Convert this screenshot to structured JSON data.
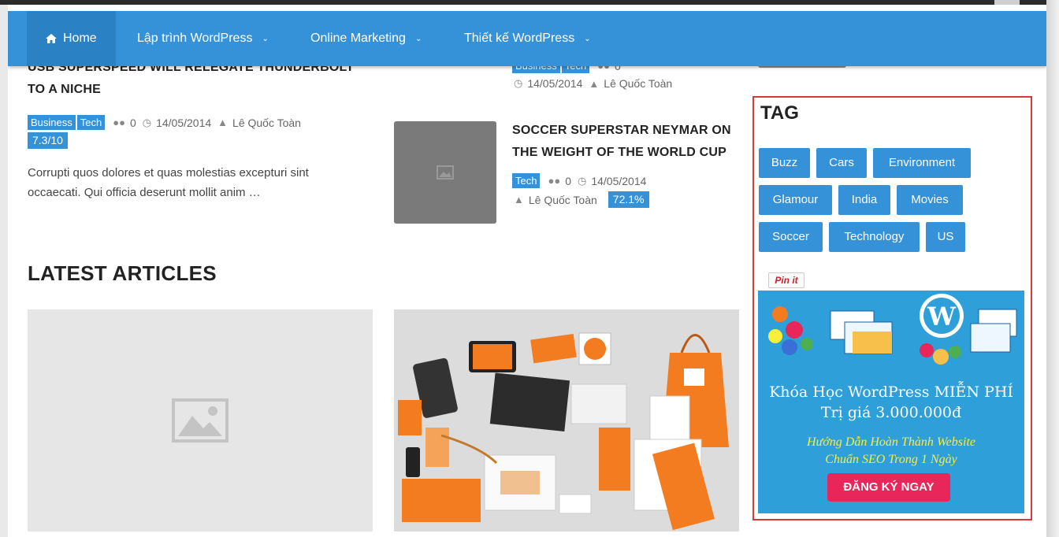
{
  "nav": {
    "items": [
      {
        "label": "Home",
        "active": true
      },
      {
        "label": "Lập trình WordPress"
      },
      {
        "label": "Online Marketing"
      },
      {
        "label": "Thiết kế WordPress"
      }
    ]
  },
  "articles": {
    "left": {
      "title_line1": "USB SUPERSPEED WILL RELEGATE THUNDERBOLT",
      "title_line2": "TO A NICHE",
      "tags": [
        "Business",
        "Tech"
      ],
      "comments": "0",
      "date": "14/05/2014",
      "author": "Lê Quốc Toàn",
      "score": "7.3/10",
      "excerpt_line1": "Corrupti quos dolores et quas molestias excepturi sint",
      "excerpt_line2": "occaecati. Qui officia deserunt mollit anim …"
    },
    "mid_top": {
      "tags": [
        "Business",
        "Tech"
      ],
      "comments": "0",
      "date": "14/05/2014",
      "author": "Lê Quốc Toàn"
    },
    "mid": {
      "title_line1": "SOCCER SUPERSTAR NEYMAR ON",
      "title_line2": "THE WEIGHT OF THE WORLD CUP",
      "tags": [
        "Tech"
      ],
      "comments": "0",
      "date": "14/05/2014",
      "author": "Lê Quốc Toàn",
      "score": "72.1%"
    }
  },
  "latest": {
    "title": "LATEST ARTICLES"
  },
  "sidebar": {
    "tag_title": "TAG",
    "tags": [
      "Buzz",
      "Cars",
      "Environment",
      "Glamour",
      "India",
      "Movies",
      "Soccer",
      "Technology",
      "US"
    ],
    "pinit": "Pin it",
    "ad": {
      "title_line1": "Khóa Học WordPress MIỄN PHÍ",
      "title_line2": "Trị giá 3.000.000đ",
      "sub_line1": "Hướng Dẫn Hoàn Thành Website",
      "sub_line2": "Chuẩn SEO Trong 1 Ngày",
      "button": "ĐĂNG KÝ NGAY"
    }
  },
  "colors": {
    "accent": "#3592d8",
    "highlight_border": "#d63a3a",
    "cta": "#e8265a"
  }
}
